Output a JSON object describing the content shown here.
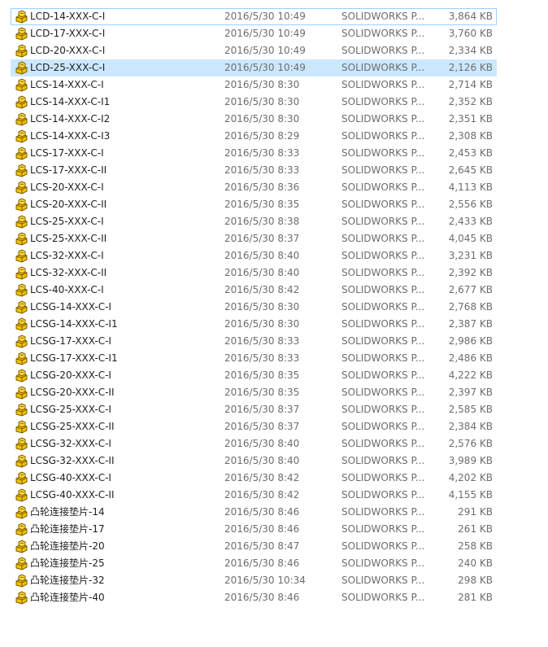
{
  "file_icon": "solidworks-part-icon",
  "colors": {
    "selection_bg": "#cce8ff",
    "focus_border": "#99d1ff",
    "icon_yellow": "#f2c200",
    "icon_outline": "#7a5a00"
  },
  "files": [
    {
      "name": "LCD-14-XXX-C-I",
      "date": "2016/5/30 10:49",
      "type": "SOLIDWORKS P...",
      "size": "3,864 KB",
      "state": "focused"
    },
    {
      "name": "LCD-17-XXX-C-I",
      "date": "2016/5/30 10:49",
      "type": "SOLIDWORKS P...",
      "size": "3,760 KB",
      "state": ""
    },
    {
      "name": "LCD-20-XXX-C-I",
      "date": "2016/5/30 10:49",
      "type": "SOLIDWORKS P...",
      "size": "2,334 KB",
      "state": ""
    },
    {
      "name": "LCD-25-XXX-C-I",
      "date": "2016/5/30 10:49",
      "type": "SOLIDWORKS P...",
      "size": "2,126 KB",
      "state": "selected"
    },
    {
      "name": "LCS-14-XXX-C-I",
      "date": "2016/5/30 8:30",
      "type": "SOLIDWORKS P...",
      "size": "2,714 KB",
      "state": ""
    },
    {
      "name": "LCS-14-XXX-C-I1",
      "date": "2016/5/30 8:30",
      "type": "SOLIDWORKS P...",
      "size": "2,352 KB",
      "state": ""
    },
    {
      "name": "LCS-14-XXX-C-I2",
      "date": "2016/5/30 8:30",
      "type": "SOLIDWORKS P...",
      "size": "2,351 KB",
      "state": ""
    },
    {
      "name": "LCS-14-XXX-C-I3",
      "date": "2016/5/30 8:29",
      "type": "SOLIDWORKS P...",
      "size": "2,308 KB",
      "state": ""
    },
    {
      "name": "LCS-17-XXX-C-I",
      "date": "2016/5/30 8:33",
      "type": "SOLIDWORKS P...",
      "size": "2,453 KB",
      "state": ""
    },
    {
      "name": "LCS-17-XXX-C-II",
      "date": "2016/5/30 8:33",
      "type": "SOLIDWORKS P...",
      "size": "2,645 KB",
      "state": ""
    },
    {
      "name": "LCS-20-XXX-C-I",
      "date": "2016/5/30 8:36",
      "type": "SOLIDWORKS P...",
      "size": "4,113 KB",
      "state": ""
    },
    {
      "name": "LCS-20-XXX-C-II",
      "date": "2016/5/30 8:35",
      "type": "SOLIDWORKS P...",
      "size": "2,556 KB",
      "state": ""
    },
    {
      "name": "LCS-25-XXX-C-I",
      "date": "2016/5/30 8:38",
      "type": "SOLIDWORKS P...",
      "size": "2,433 KB",
      "state": ""
    },
    {
      "name": "LCS-25-XXX-C-II",
      "date": "2016/5/30 8:37",
      "type": "SOLIDWORKS P...",
      "size": "4,045 KB",
      "state": ""
    },
    {
      "name": "LCS-32-XXX-C-I",
      "date": "2016/5/30 8:40",
      "type": "SOLIDWORKS P...",
      "size": "3,231 KB",
      "state": ""
    },
    {
      "name": "LCS-32-XXX-C-II",
      "date": "2016/5/30 8:40",
      "type": "SOLIDWORKS P...",
      "size": "2,392 KB",
      "state": ""
    },
    {
      "name": "LCS-40-XXX-C-I",
      "date": "2016/5/30 8:42",
      "type": "SOLIDWORKS P...",
      "size": "2,677 KB",
      "state": ""
    },
    {
      "name": "LCSG-14-XXX-C-I",
      "date": "2016/5/30 8:30",
      "type": "SOLIDWORKS P...",
      "size": "2,768 KB",
      "state": ""
    },
    {
      "name": "LCSG-14-XXX-C-I1",
      "date": "2016/5/30 8:30",
      "type": "SOLIDWORKS P...",
      "size": "2,387 KB",
      "state": ""
    },
    {
      "name": "LCSG-17-XXX-C-I",
      "date": "2016/5/30 8:33",
      "type": "SOLIDWORKS P...",
      "size": "2,986 KB",
      "state": ""
    },
    {
      "name": "LCSG-17-XXX-C-I1",
      "date": "2016/5/30 8:33",
      "type": "SOLIDWORKS P...",
      "size": "2,486 KB",
      "state": ""
    },
    {
      "name": "LCSG-20-XXX-C-I",
      "date": "2016/5/30 8:35",
      "type": "SOLIDWORKS P...",
      "size": "4,222 KB",
      "state": ""
    },
    {
      "name": "LCSG-20-XXX-C-II",
      "date": "2016/5/30 8:35",
      "type": "SOLIDWORKS P...",
      "size": "2,397 KB",
      "state": ""
    },
    {
      "name": "LCSG-25-XXX-C-I",
      "date": "2016/5/30 8:37",
      "type": "SOLIDWORKS P...",
      "size": "2,585 KB",
      "state": ""
    },
    {
      "name": "LCSG-25-XXX-C-II",
      "date": "2016/5/30 8:37",
      "type": "SOLIDWORKS P...",
      "size": "2,384 KB",
      "state": ""
    },
    {
      "name": "LCSG-32-XXX-C-I",
      "date": "2016/5/30 8:40",
      "type": "SOLIDWORKS P...",
      "size": "2,576 KB",
      "state": ""
    },
    {
      "name": "LCSG-32-XXX-C-II",
      "date": "2016/5/30 8:40",
      "type": "SOLIDWORKS P...",
      "size": "3,989 KB",
      "state": ""
    },
    {
      "name": "LCSG-40-XXX-C-I",
      "date": "2016/5/30 8:42",
      "type": "SOLIDWORKS P...",
      "size": "4,202 KB",
      "state": ""
    },
    {
      "name": "LCSG-40-XXX-C-II",
      "date": "2016/5/30 8:42",
      "type": "SOLIDWORKS P...",
      "size": "4,155 KB",
      "state": ""
    },
    {
      "name": "凸轮连接垫片-14",
      "date": "2016/5/30 8:46",
      "type": "SOLIDWORKS P...",
      "size": "291 KB",
      "state": ""
    },
    {
      "name": "凸轮连接垫片-17",
      "date": "2016/5/30 8:46",
      "type": "SOLIDWORKS P...",
      "size": "261 KB",
      "state": ""
    },
    {
      "name": "凸轮连接垫片-20",
      "date": "2016/5/30 8:47",
      "type": "SOLIDWORKS P...",
      "size": "258 KB",
      "state": ""
    },
    {
      "name": "凸轮连接垫片-25",
      "date": "2016/5/30 8:46",
      "type": "SOLIDWORKS P...",
      "size": "240 KB",
      "state": ""
    },
    {
      "name": "凸轮连接垫片-32",
      "date": "2016/5/30 10:34",
      "type": "SOLIDWORKS P...",
      "size": "298 KB",
      "state": ""
    },
    {
      "name": "凸轮连接垫片-40",
      "date": "2016/5/30 8:46",
      "type": "SOLIDWORKS P...",
      "size": "281 KB",
      "state": ""
    }
  ]
}
